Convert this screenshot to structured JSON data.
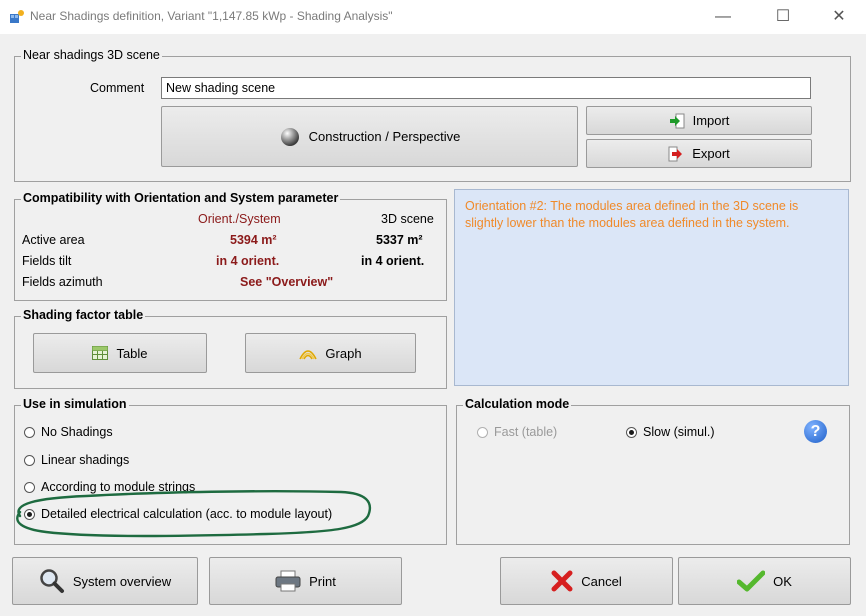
{
  "window": {
    "title": "Near Shadings definition, Variant \"1,147.85 kWp - Shading Analysis\"",
    "minimize": "—",
    "maximize": "☐",
    "close": "✕"
  },
  "scene": {
    "group_title": "Near shadings 3D scene",
    "comment_label": "Comment",
    "comment_value": "New shading scene",
    "construction_label": "Construction / Perspective",
    "import_label": "Import",
    "export_label": "Export"
  },
  "compat": {
    "group_title": "Compatibility with Orientation and System parameter",
    "col_orient": "Orient./System",
    "col_scene": "3D scene",
    "rows": [
      {
        "label": "Active area",
        "orient": "5394 m²",
        "scene": "5337 m²"
      },
      {
        "label": "Fields tilt",
        "orient": "in 4 orient.",
        "scene": "in 4 orient."
      },
      {
        "label": "Fields azimuth",
        "orient": "See \"Overview\"",
        "scene": ""
      }
    ]
  },
  "info": {
    "message": "Orientation #2:  The modules area defined in the 3D scene is slightly lower than the modules area defined in the system."
  },
  "shading_table": {
    "group_title": "Shading factor table",
    "table_label": "Table",
    "graph_label": "Graph"
  },
  "simulation": {
    "group_title": "Use in simulation",
    "options": [
      {
        "label": "No Shadings",
        "selected": false
      },
      {
        "label": "Linear shadings",
        "selected": false
      },
      {
        "label": "According to module strings",
        "selected": false
      },
      {
        "label": "Detailed electrical calculation (acc. to module layout)",
        "selected": true
      }
    ]
  },
  "calc_mode": {
    "group_title": "Calculation mode",
    "fast_label": "Fast (table)",
    "slow_label": "Slow (simul.)",
    "help": "?"
  },
  "footer": {
    "overview_label": "System overview",
    "print_label": "Print",
    "cancel_label": "Cancel",
    "ok_label": "OK"
  },
  "colors": {
    "accent_red": "#8b1a1a",
    "info_text": "#f08a2a",
    "info_bg": "#dbe6f7",
    "highlight_green": "#1e6b40"
  }
}
